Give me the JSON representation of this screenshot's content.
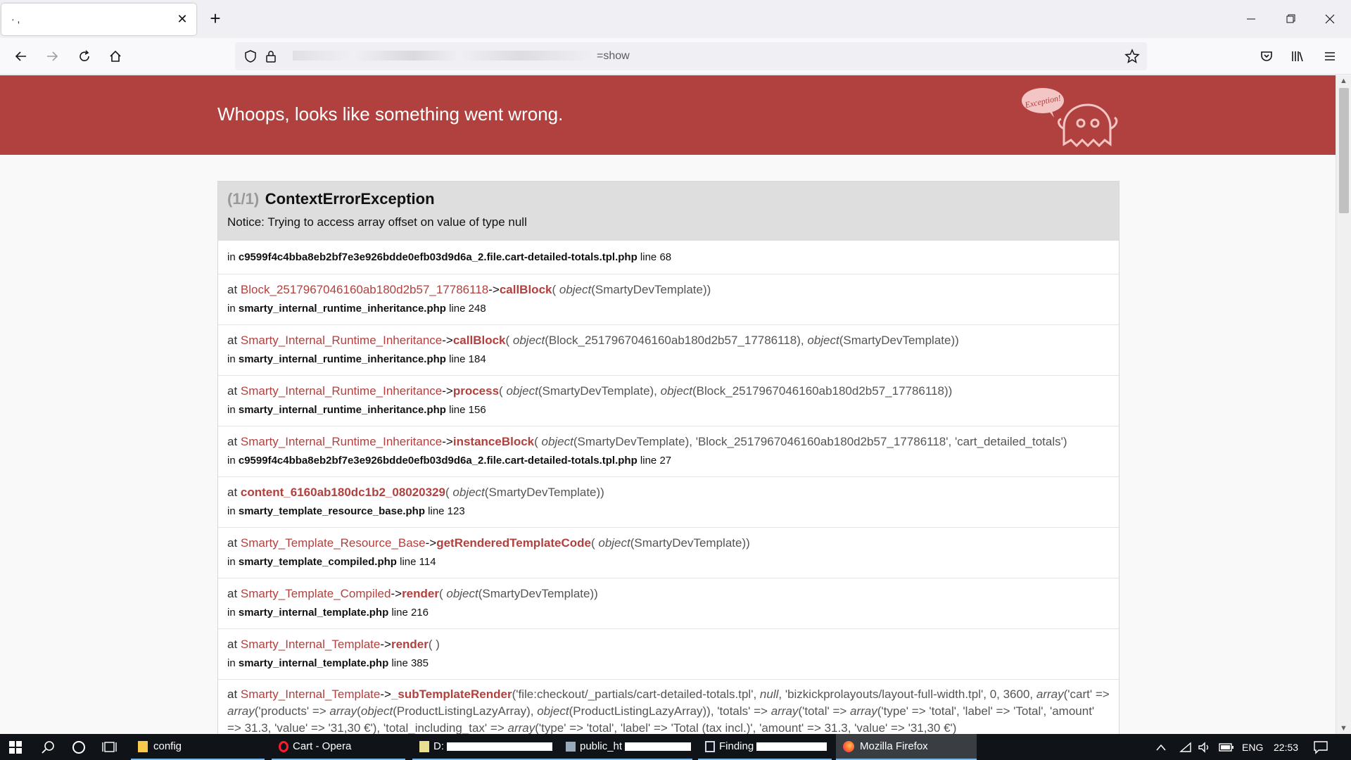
{
  "browser": {
    "tab_title": "                  ·  ,",
    "url_suffix": "=show",
    "app_name": "Mozilla Firefox"
  },
  "page": {
    "headline": "Whoops, looks like something went wrong.",
    "ghost_label": "Exception!",
    "exception": {
      "count": "(1/1)",
      "name": "ContextErrorException",
      "message": "Notice: Trying to access array offset on value of type null",
      "location": {
        "prefix": "in",
        "file": "c9599f4c4bba8eb2bf7e3e926bdde0efb03d9d6a_2.file.cart-detailed-totals.tpl.php",
        "line": "line 68"
      }
    },
    "trace": [
      {
        "at": "at",
        "class": "Block_2517967046160ab180d2b57_17786118",
        "arrow": "->",
        "fn": "callBlock",
        "args_html": "( <i>object</i>(SmartyDevTemplate))",
        "in": "in",
        "file": "smarty_internal_runtime_inheritance.php",
        "line": "line 248"
      },
      {
        "at": "at",
        "class": "Smarty_Internal_Runtime_Inheritance",
        "arrow": "->",
        "fn": "callBlock",
        "args_html": "( <i>object</i>(Block_2517967046160ab180d2b57_17786118), <i>object</i>(SmartyDevTemplate))",
        "in": "in",
        "file": "smarty_internal_runtime_inheritance.php",
        "line": "line 184"
      },
      {
        "at": "at",
        "class": "Smarty_Internal_Runtime_Inheritance",
        "arrow": "->",
        "fn": "process",
        "args_html": "( <i>object</i>(SmartyDevTemplate), <i>object</i>(Block_2517967046160ab180d2b57_17786118))",
        "in": "in",
        "file": "smarty_internal_runtime_inheritance.php",
        "line": "line 156"
      },
      {
        "at": "at",
        "class": "Smarty_Internal_Runtime_Inheritance",
        "arrow": "->",
        "fn": "instanceBlock",
        "args_html": "( <i>object</i>(SmartyDevTemplate), 'Block_2517967046160ab180d2b57_17786118', 'cart_detailed_totals')",
        "in": "in",
        "file": "c9599f4c4bba8eb2bf7e3e926bdde0efb03d9d6a_2.file.cart-detailed-totals.tpl.php",
        "line": "line 27"
      },
      {
        "at": "at",
        "class": "",
        "arrow": "",
        "fn": "content_6160ab180dc1b2_08020329",
        "args_html": "( <i>object</i>(SmartyDevTemplate))",
        "in": "in",
        "file": "smarty_template_resource_base.php",
        "line": "line 123"
      },
      {
        "at": "at",
        "class": "Smarty_Template_Resource_Base",
        "arrow": "->",
        "fn": "getRenderedTemplateCode",
        "args_html": "( <i>object</i>(SmartyDevTemplate))",
        "in": "in",
        "file": "smarty_template_compiled.php",
        "line": "line 114"
      },
      {
        "at": "at",
        "class": "Smarty_Template_Compiled",
        "arrow": "->",
        "fn": "render",
        "args_html": "( <i>object</i>(SmartyDevTemplate))",
        "in": "in",
        "file": "smarty_internal_template.php",
        "line": "line 216"
      },
      {
        "at": "at",
        "class": "Smarty_Internal_Template",
        "arrow": "->",
        "fn": "render",
        "args_html": "( )",
        "in": "in",
        "file": "smarty_internal_template.php",
        "line": "line 385"
      }
    ],
    "last_trace": {
      "at": "at",
      "class": "Smarty_Internal_Template",
      "arrow": "->",
      "fn": "_subTemplateRender",
      "args_html": "('file:checkout/_partials/cart-detailed-totals.tpl', <i>null</i>, 'bizkickprolayouts/layout-full-width.tpl', 0, 3600, <i>array</i>('cart' =&gt; <i>array</i>('products' =&gt; <i>array</i>(<i>object</i>(ProductListingLazyArray), <i>object</i>(ProductListingLazyArray)), 'totals' =&gt; <i>array</i>('total' =&gt; <i>array</i>('type' =&gt; 'total', 'label' =&gt; 'Total', 'amount' =&gt; 31.3, 'value' =&gt; '31,30 €'), 'total_including_tax' =&gt; <i>array</i>('type' =&gt; 'total', 'label' =&gt; 'Total (tax incl.)', 'amount' =&gt; 31.3, 'value' =&gt; '31,30 €')"
    }
  },
  "taskbar": {
    "apps": [
      {
        "label": "config"
      },
      {
        "label": "Cart - Opera"
      },
      {
        "label": "D:"
      },
      {
        "label": "public_ht"
      },
      {
        "label": "Finding"
      },
      {
        "label": "Mozilla Firefox"
      }
    ],
    "lang": "ENG",
    "time": "22:53"
  }
}
